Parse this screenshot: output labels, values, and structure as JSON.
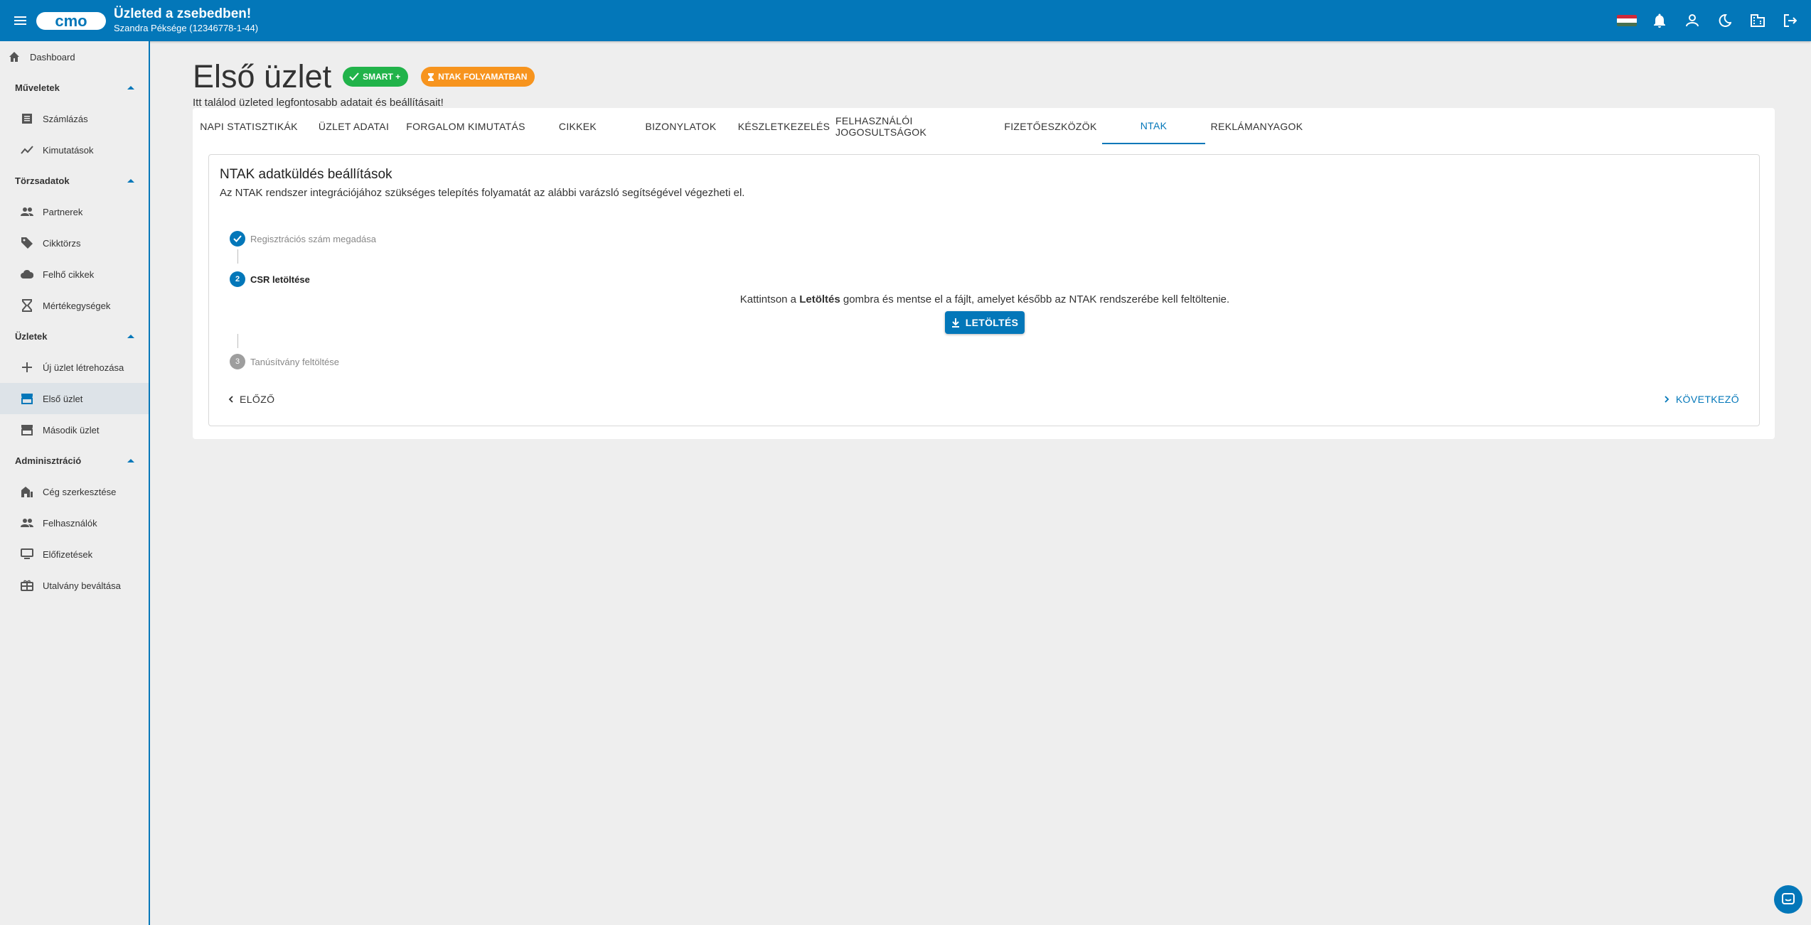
{
  "app": {
    "title": "Üzleted a zsebedben!",
    "subtitle": "Szandra Péksége (12346778-1-44)",
    "brand_color": "#0377b9",
    "topbar_icons": [
      "hungarian-flag-icon",
      "bell-icon",
      "account-icon",
      "dark-mode-icon",
      "business-icon",
      "logout-icon"
    ]
  },
  "sidebar": {
    "dashboard": "Dashboard",
    "sections": [
      {
        "label": "Műveletek",
        "items": [
          "Számlázás",
          "Kimutatások"
        ]
      },
      {
        "label": "Törzsadatok",
        "items": [
          "Partnerek",
          "Cikktörzs",
          "Felhő cikkek",
          "Mértékegységek"
        ]
      },
      {
        "label": "Üzletek",
        "items": [
          "Új üzlet létrehozása",
          "Első üzlet",
          "Második üzlet"
        ]
      },
      {
        "label": "Adminisztráció",
        "items": [
          "Cég szerkesztése",
          "Felhasználók",
          "Előfizetések",
          "Utalvány beváltása"
        ]
      }
    ],
    "active_item": "Első üzlet"
  },
  "page": {
    "title": "Első üzlet",
    "badge_smart": "SMART +",
    "badge_ntak": "NTAK FOLYAMATBAN",
    "subtitle": "Itt találod üzleted legfontosabb adatait és beállításait!"
  },
  "tabs": [
    "NAPI STATISZTIKÁK",
    "ÜZLET ADATAI",
    "FORGALOM KIMUTATÁS",
    "CIKKEK",
    "BIZONYLATOK",
    "KÉSZLETKEZELÉS",
    "FELHASZNÁLÓI JOGOSULTSÁGOK",
    "FIZETŐESZKÖZÖK",
    "NTAK",
    "REKLÁMANYAGOK"
  ],
  "active_tab": "NTAK",
  "ntak": {
    "heading": "NTAK adatküldés beállítások",
    "description": "Az NTAK rendszer integrációjához szükséges telepítés folyamatát az alábbi varázsló segítségével végezheti el.",
    "steps": [
      {
        "number": "1",
        "label": "Regisztrációs szám megadása",
        "state": "done"
      },
      {
        "number": "2",
        "label": "CSR letöltése",
        "state": "active"
      },
      {
        "number": "3",
        "label": "Tanúsítvány feltöltése",
        "state": "pending"
      }
    ],
    "step_text_before": "Kattintson a ",
    "step_text_bold": "Letöltés",
    "step_text_after": " gombra és mentse el a fájlt, amelyet később az NTAK rendszerébe kell feltöltenie.",
    "download_label": "LETÖLTÉS",
    "prev_label": "ELŐZŐ",
    "next_label": "KÖVETKEZŐ"
  }
}
